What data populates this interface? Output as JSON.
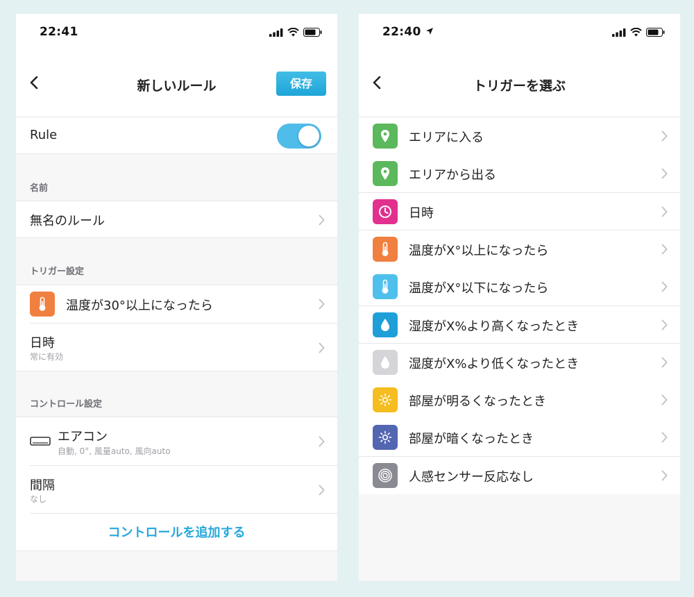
{
  "left": {
    "status": {
      "time": "22:41"
    },
    "nav": {
      "title": "新しいルール",
      "save_label": "保存"
    },
    "rule": {
      "label": "Rule",
      "enabled": true
    },
    "name_section": {
      "header": "名前",
      "value": "無名のルール"
    },
    "trigger_section": {
      "header": "トリガー設定",
      "trigger": {
        "label": "温度が30°以上になったら",
        "icon": "thermometer-icon",
        "color": "#f08040"
      },
      "datetime": {
        "label": "日時",
        "sub": "常に有効"
      }
    },
    "control_section": {
      "header": "コントロール設定",
      "aircon": {
        "label": "エアコン",
        "sub": "自動, 0°, 風量auto, 風向auto",
        "icon": "air-conditioner-icon"
      },
      "interval": {
        "label": "間隔",
        "sub": "なし"
      },
      "add_label": "コントロールを追加する"
    }
  },
  "right": {
    "status": {
      "time": "22:40"
    },
    "nav": {
      "title": "トリガーを選ぶ"
    },
    "triggers": [
      {
        "label": "エリアに入る",
        "icon": "location-pin-icon",
        "color": "#5cb85c"
      },
      {
        "label": "エリアから出る",
        "icon": "location-pin-icon",
        "color": "#5cb85c"
      },
      {
        "label": "日時",
        "icon": "clock-icon",
        "color": "#e2308f"
      },
      {
        "label": "温度がX°以上になったら",
        "icon": "thermometer-icon",
        "color": "#f08040"
      },
      {
        "label": "温度がX°以下になったら",
        "icon": "thermometer-icon",
        "color": "#4fc0ec"
      },
      {
        "label": "湿度がX%より高くなったとき",
        "icon": "water-drop-icon",
        "color": "#1f9fd8"
      },
      {
        "label": "湿度がX%より低くなったとき",
        "icon": "water-drop-icon",
        "color": "#d4d4d9"
      },
      {
        "label": "部屋が明るくなったとき",
        "icon": "sun-icon",
        "color": "#f5bd1f"
      },
      {
        "label": "部屋が暗くなったとき",
        "icon": "sun-icon",
        "color": "#5366b2"
      },
      {
        "label": "人感センサー反応なし",
        "icon": "motion-sensor-icon",
        "color": "#8a8a92"
      }
    ]
  }
}
